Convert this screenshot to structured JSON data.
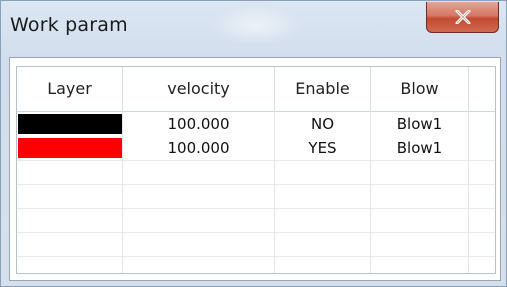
{
  "window": {
    "title": "Work param",
    "close_label": "X"
  },
  "table": {
    "columns": [
      "Layer",
      "velocity",
      "Enable",
      "Blow"
    ],
    "rows": [
      {
        "layer_color": "#000000",
        "velocity": "100.000",
        "enable": "NO",
        "blow": "Blow1"
      },
      {
        "layer_color": "#ff0000",
        "velocity": "100.000",
        "enable": "YES",
        "blow": "Blow1"
      }
    ]
  },
  "colors": {
    "title_bar": "#d2deed",
    "close_button": "#c24a33",
    "grid_line": "#e2e5e9"
  }
}
